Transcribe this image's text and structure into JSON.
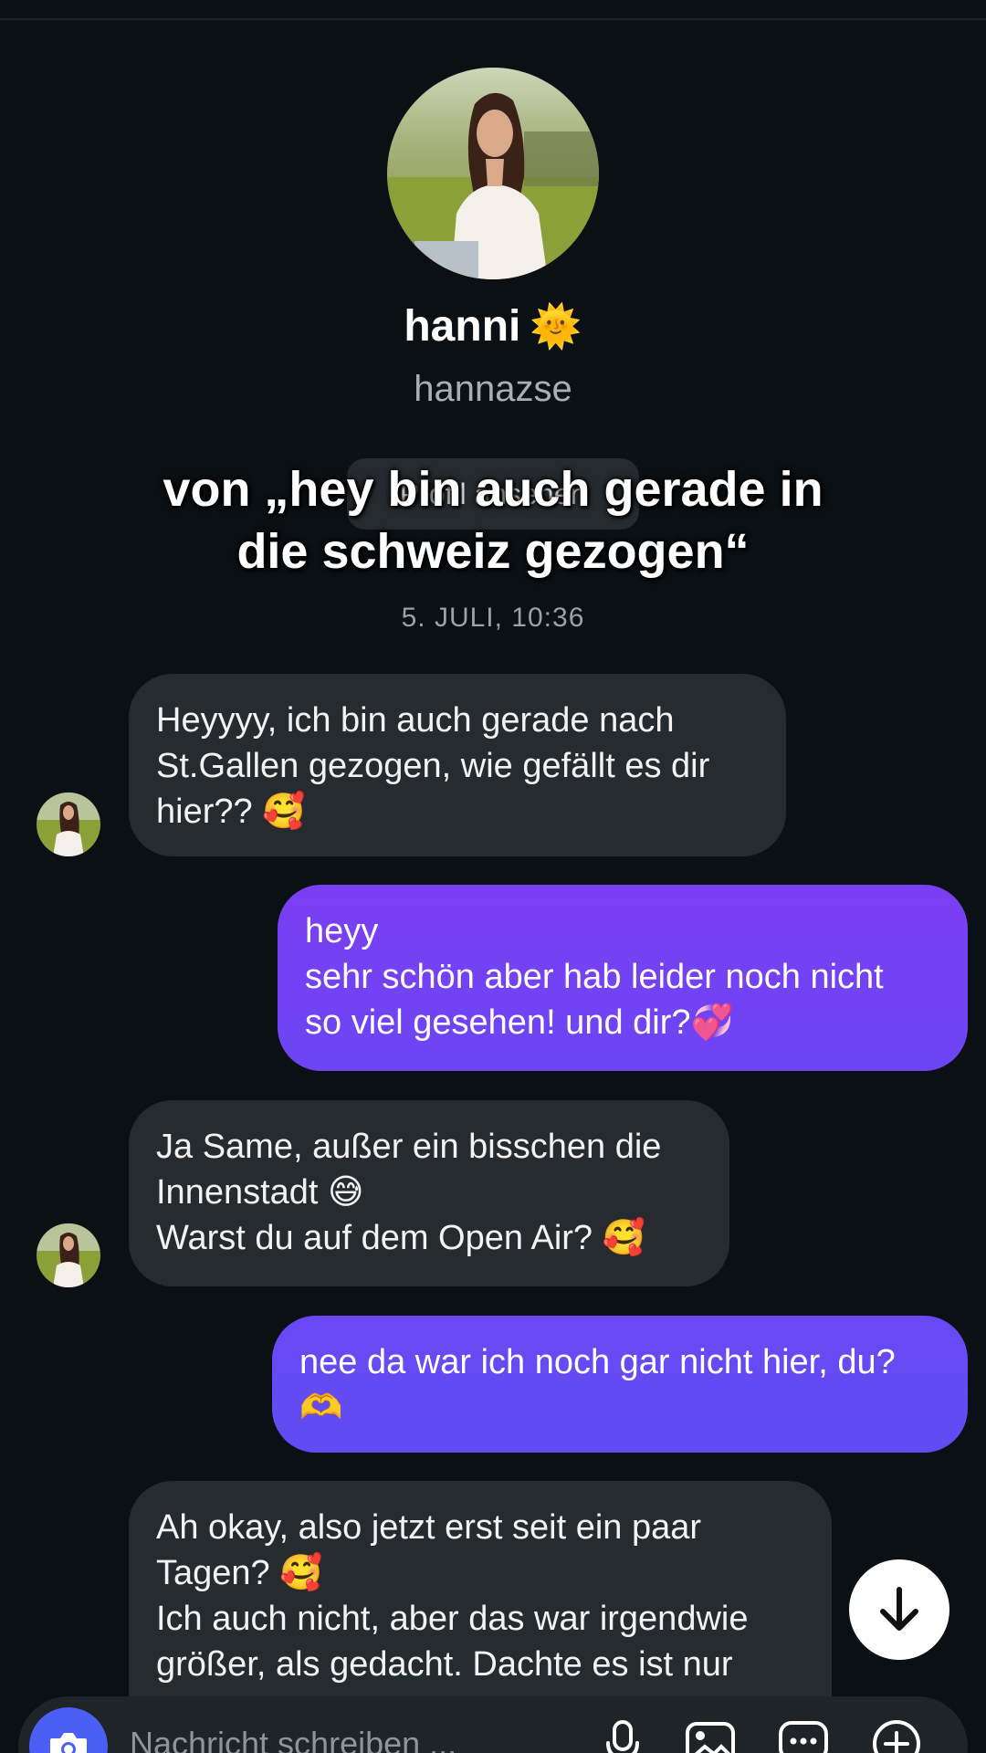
{
  "profile": {
    "name": "hanni",
    "name_emoji": "🌞",
    "username": "hannazse",
    "view_profile_label": "Profil ansehen"
  },
  "overlay": {
    "caption": "von „hey bin auch gerade in\ndie schweiz gezogen“"
  },
  "conversation": {
    "date_separator": "5. JULI, 10:36",
    "messages": [
      {
        "direction": "incoming",
        "text": "Heyyyy, ich bin auch gerade nach\nSt.Gallen gezogen, wie gefällt es dir\nhier?? 🥰"
      },
      {
        "direction": "outgoing",
        "text": "heyy\nsehr schön aber hab leider noch nicht\nso viel gesehen! und dir?💞"
      },
      {
        "direction": "incoming",
        "text": "Ja Same, außer ein bisschen die\nInnenstadt 😅\nWarst du auf dem Open Air? 🥰"
      },
      {
        "direction": "outgoing",
        "text": "nee da war ich noch gar nicht hier, du?\n🫶"
      },
      {
        "direction": "incoming",
        "text": "Ah okay, also jetzt erst seit ein paar\nTagen? 🥰\nIch auch nicht, aber das war irgendwie\ngrößer, als gedacht. Dachte es ist nur"
      }
    ]
  },
  "composer": {
    "placeholder": "Nachricht schreiben ..."
  },
  "colors": {
    "background": "#0b1014",
    "incoming_bubble": "#262b30",
    "outgoing_bubble": "#7b3ff2",
    "camera_button": "#4b5ff5"
  },
  "icons": {
    "scroll": "arrow-down-icon",
    "camera": "camera-icon",
    "mic": "microphone-icon",
    "gallery": "gallery-icon",
    "sticker": "sticker-icon",
    "more": "plus-circle-icon"
  }
}
